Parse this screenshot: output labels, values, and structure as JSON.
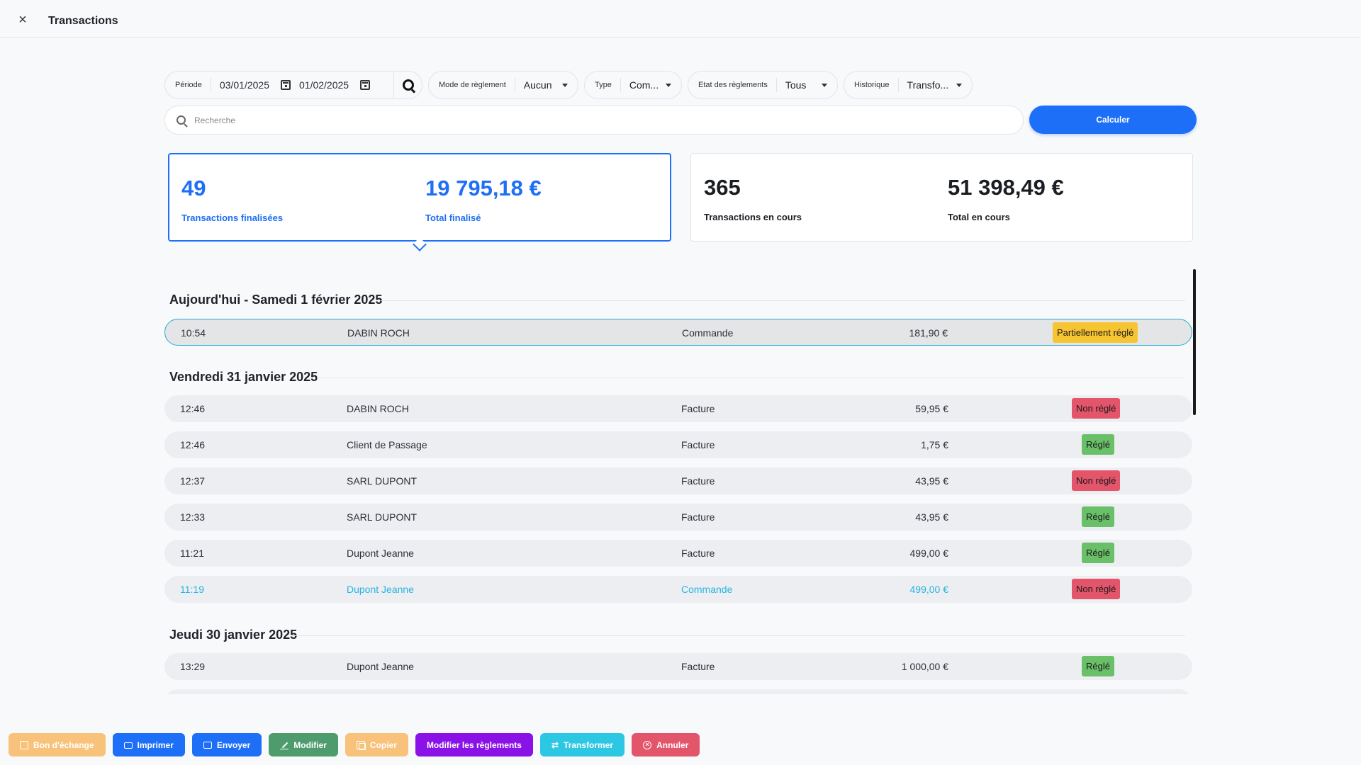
{
  "header": {
    "title": "Transactions",
    "close_icon": "close-icon"
  },
  "filters": {
    "period": {
      "label": "Période",
      "start": "03/01/2025",
      "end": "01/02/2025"
    },
    "payment_mode": {
      "label": "Mode de règlement",
      "value": "Aucun"
    },
    "type": {
      "label": "Type",
      "value": "Com..."
    },
    "payment_state": {
      "label": "Etat des règlements",
      "value": "Tous"
    },
    "history": {
      "label": "Historique",
      "value": "Transfo..."
    }
  },
  "search": {
    "placeholder": "Recherche",
    "value": ""
  },
  "calculate_label": "Calculer",
  "summary": {
    "finalized": {
      "count": "49",
      "count_label": "Transactions finalisées",
      "total": "19 795,18 €",
      "total_label": "Total finalisé"
    },
    "in_progress": {
      "count": "365",
      "count_label": "Transactions en cours",
      "total": "51 398,49 €",
      "total_label": "Total en cours"
    }
  },
  "groups": [
    {
      "title": "Aujourd'hui - Samedi 1 février 2025",
      "rows": [
        {
          "time": "10:54",
          "client": "DABIN ROCH",
          "type": "Commande",
          "amount": "181,90 €",
          "status": "Partiellement réglé"
        }
      ]
    },
    {
      "title": "Vendredi 31 janvier 2025",
      "rows": [
        {
          "time": "12:46",
          "client": "DABIN ROCH",
          "type": "Facture",
          "amount": "59,95 €",
          "status": "Non réglé"
        },
        {
          "time": "12:46",
          "client": "Client de Passage",
          "type": "Facture",
          "amount": "1,75 €",
          "status": "Réglé"
        },
        {
          "time": "12:37",
          "client": "SARL DUPONT",
          "type": "Facture",
          "amount": "43,95 €",
          "status": "Non réglé"
        },
        {
          "time": "12:33",
          "client": "SARL DUPONT",
          "type": "Facture",
          "amount": "43,95 €",
          "status": "Réglé"
        },
        {
          "time": "11:21",
          "client": "Dupont Jeanne",
          "type": "Facture",
          "amount": "499,00 €",
          "status": "Réglé"
        },
        {
          "time": "11:19",
          "client": "Dupont Jeanne",
          "type": "Commande",
          "amount": "499,00 €",
          "status": "Non réglé"
        }
      ]
    },
    {
      "title": "Jeudi 30 janvier 2025",
      "rows": [
        {
          "time": "13:29",
          "client": "Dupont Jeanne",
          "type": "Facture",
          "amount": "1 000,00 €",
          "status": "Réglé"
        }
      ]
    }
  ],
  "toolbar": {
    "exchange": "Bon d'échange",
    "print": "Imprimer",
    "send": "Envoyer",
    "edit": "Modifier",
    "copy": "Copier",
    "edit_payments": "Modifier les règlements",
    "transform": "Transformer",
    "cancel": "Annuler"
  },
  "colors": {
    "accent": "#1e6ff7",
    "partial": "#f7c531",
    "unpaid": "#e2556a",
    "paid": "#6abf69",
    "highlight": "#27b5e0"
  }
}
